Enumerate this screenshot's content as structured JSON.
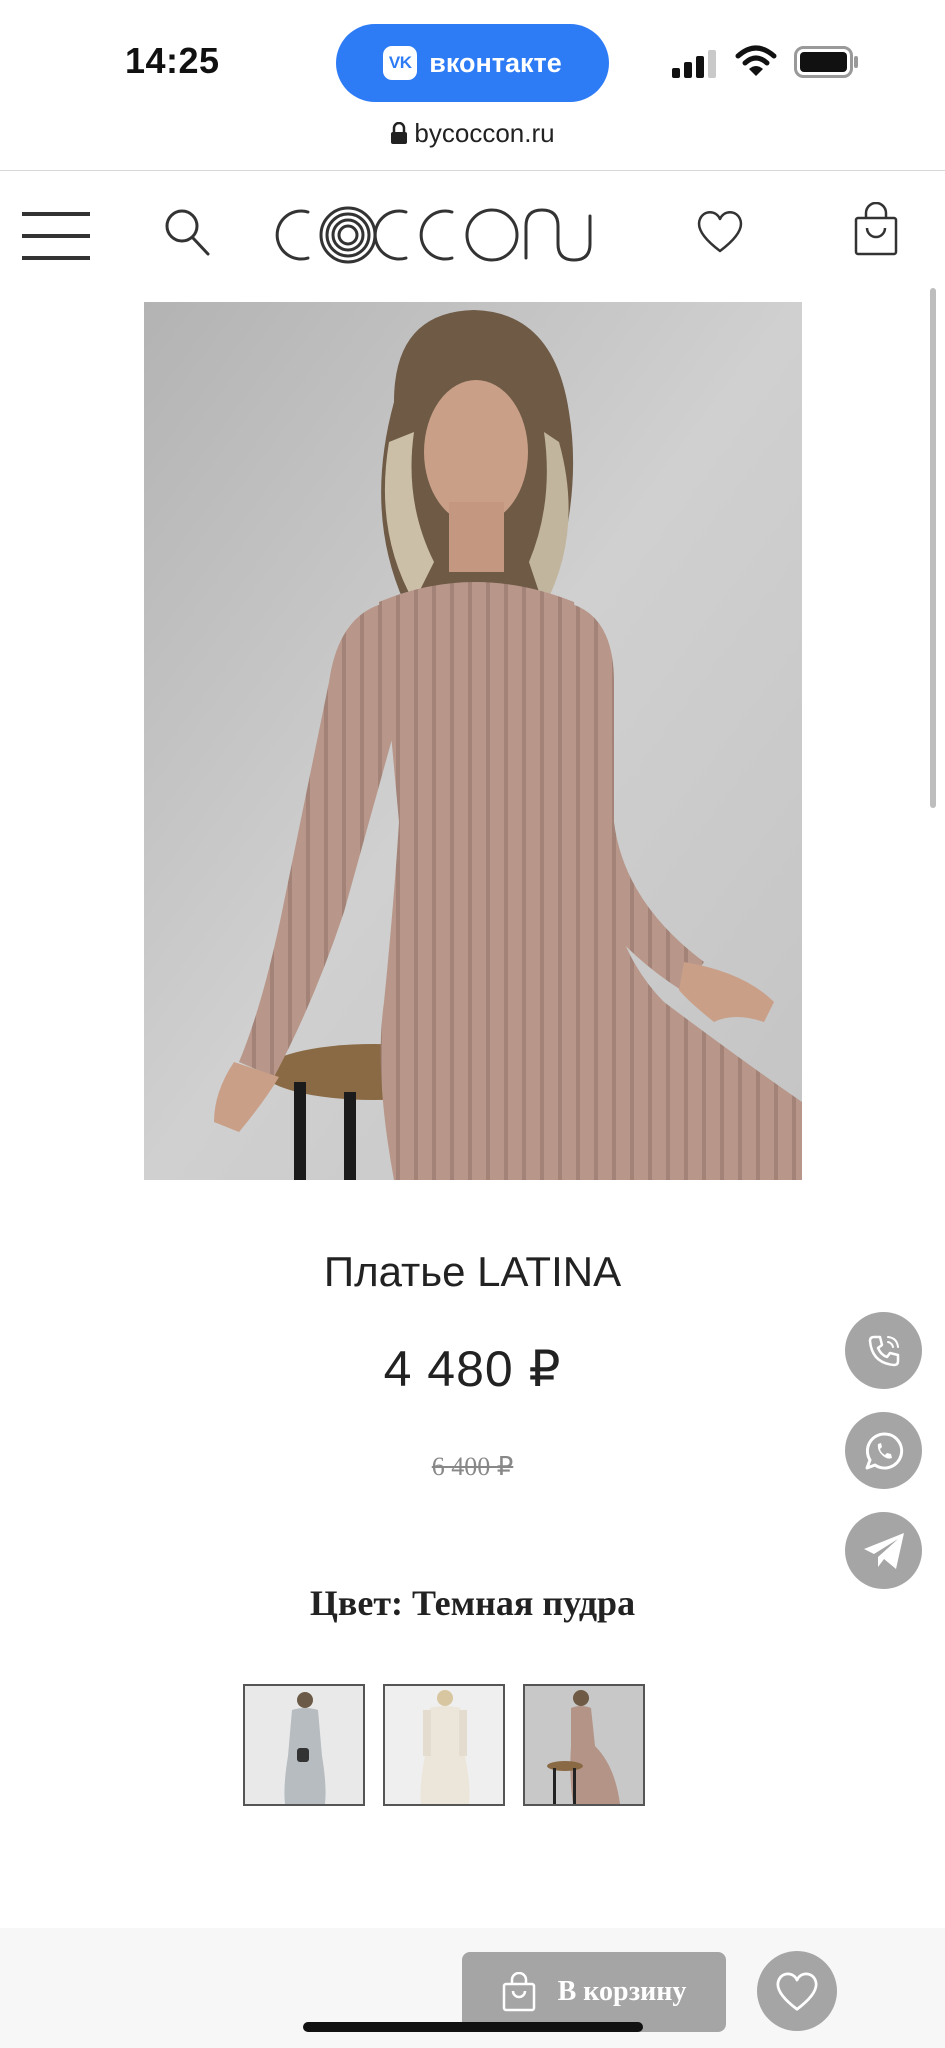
{
  "status_bar": {
    "time": "14:25",
    "app_pill": {
      "label": "вконтакте",
      "logo_text": "VK"
    }
  },
  "browser": {
    "url": "bycoccon.ru"
  },
  "header": {
    "logo_name": "coccon-logo"
  },
  "product": {
    "title": "Платье LATINA",
    "price": "4 480 ₽",
    "old_price": "6 400 ₽",
    "color_line": "Цвет: Темная пудра"
  },
  "swatches": [
    {
      "name": "swatch-grey",
      "color": "#b6bcc0"
    },
    {
      "name": "swatch-milk",
      "color": "#ece6da"
    },
    {
      "name": "swatch-dark-powder",
      "color": "#b49486"
    }
  ],
  "contacts": [
    {
      "name": "phone-contact-button",
      "icon": "phone-icon"
    },
    {
      "name": "whatsapp-contact-button",
      "icon": "whatsapp-icon"
    },
    {
      "name": "telegram-contact-button",
      "icon": "telegram-icon"
    }
  ],
  "bottom_bar": {
    "cart_label": "В корзину"
  },
  "colors": {
    "accent_blue": "#2e7bf6",
    "button_grey": "#a5a5a5",
    "dress": "#b8978a"
  }
}
